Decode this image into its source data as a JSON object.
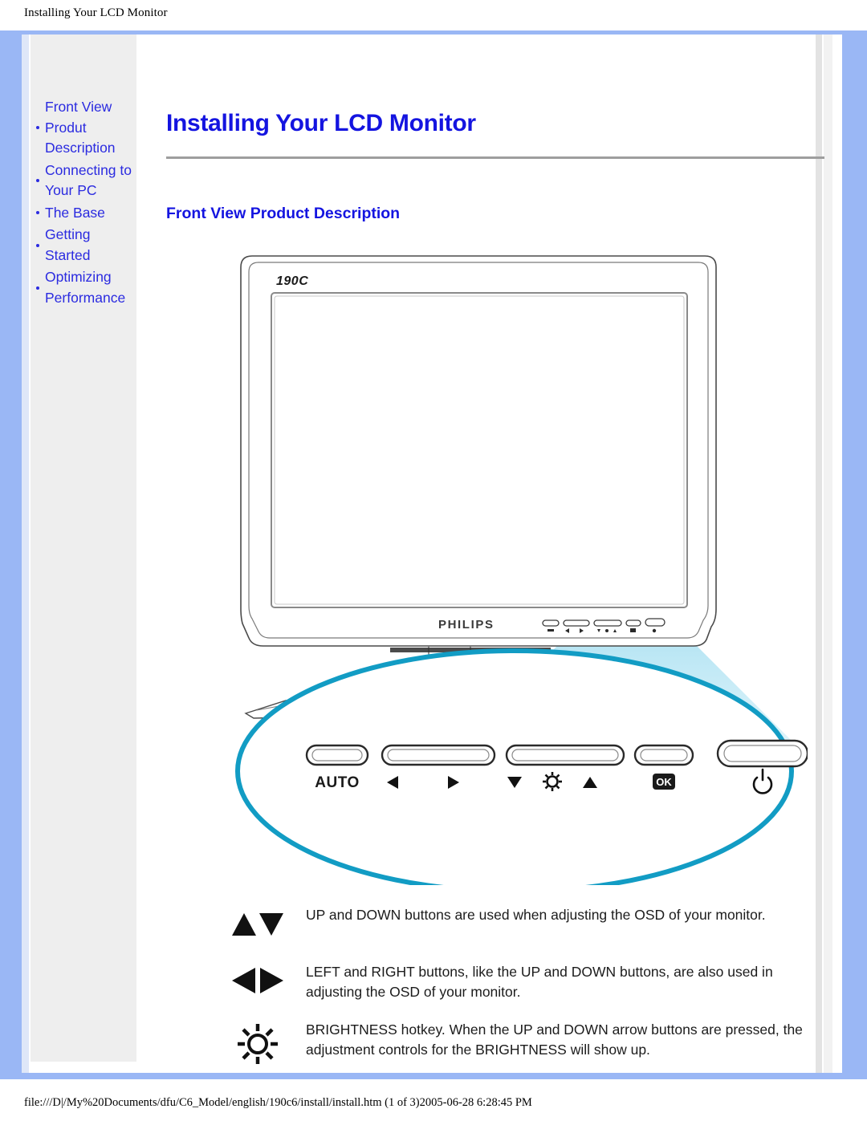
{
  "print": {
    "header": "Installing Your LCD Monitor",
    "footer": "file:///D|/My%20Documents/dfu/C6_Model/english/190c6/install/install.htm (1 of 3)2005-06-28 6:28:45 PM"
  },
  "colors": {
    "frame_blue": "#9ab7f5",
    "link_blue": "#2b2be0",
    "heading_blue": "#1414e0",
    "sidebar_gray": "#eeeeee",
    "callout_cyan": "#1a9cc4",
    "cone_cyan": "#aadff0"
  },
  "sidebar": {
    "items": [
      {
        "label": "Front View Produt Description"
      },
      {
        "label": "Connecting to Your PC"
      },
      {
        "label": "The Base"
      },
      {
        "label": "Getting Started"
      },
      {
        "label": "Optimizing Performance"
      }
    ]
  },
  "main": {
    "page_title": "Installing Your LCD Monitor",
    "section_title": "Front View Product Description"
  },
  "illustration": {
    "model_label": "190C",
    "brand_label": "PHILIPS",
    "buttons": [
      {
        "name": "auto-button",
        "label": "AUTO"
      },
      {
        "name": "left-right-button",
        "label": "◀        ▶"
      },
      {
        "name": "down-brightness-up-button",
        "label": "▼  ☼  ▲"
      },
      {
        "name": "ok-button",
        "label": "OK"
      },
      {
        "name": "power-button",
        "label": "⏻"
      }
    ]
  },
  "legend": {
    "rows": [
      {
        "icon": "up-down-arrows-icon",
        "text": "UP and DOWN buttons are used when adjusting the OSD of your monitor."
      },
      {
        "icon": "left-right-arrows-icon",
        "text": "LEFT and RIGHT buttons, like the UP and DOWN buttons, are also used in adjusting the OSD of your monitor."
      },
      {
        "icon": "brightness-sun-icon",
        "text": "BRIGHTNESS hotkey. When the UP and DOWN arrow buttons are pressed, the adjustment controls for the BRIGHTNESS will show up."
      }
    ]
  }
}
